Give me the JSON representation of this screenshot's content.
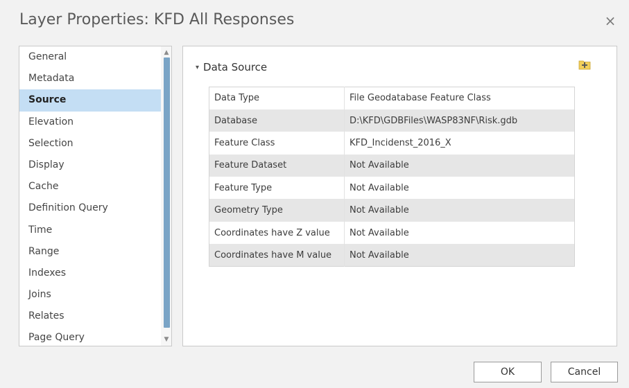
{
  "window": {
    "title": "Layer Properties: KFD All Responses",
    "close_glyph": "×"
  },
  "sidebar": {
    "selected": "Source",
    "items": [
      {
        "label": "General"
      },
      {
        "label": "Metadata"
      },
      {
        "label": "Source"
      },
      {
        "label": "Elevation"
      },
      {
        "label": "Selection"
      },
      {
        "label": "Display"
      },
      {
        "label": "Cache"
      },
      {
        "label": "Definition Query"
      },
      {
        "label": "Time"
      },
      {
        "label": "Range"
      },
      {
        "label": "Indexes"
      },
      {
        "label": "Joins"
      },
      {
        "label": "Relates"
      },
      {
        "label": "Page Query"
      }
    ]
  },
  "section": {
    "title": "Data Source",
    "chevron": "▾",
    "add_icon": "add-data-icon",
    "rows": [
      {
        "key": "Data Type",
        "value": "File Geodatabase Feature Class"
      },
      {
        "key": "Database",
        "value": "D:\\KFD\\GDBFiles\\WASP83NF\\Risk.gdb"
      },
      {
        "key": "Feature Class",
        "value": "KFD_Incidenst_2016_X"
      },
      {
        "key": "Feature Dataset",
        "value": "Not Available"
      },
      {
        "key": "Feature Type",
        "value": "Not Available"
      },
      {
        "key": "Geometry Type",
        "value": "Not Available"
      },
      {
        "key": "Coordinates have Z value",
        "value": "Not Available"
      },
      {
        "key": "Coordinates have M value",
        "value": "Not Available"
      }
    ]
  },
  "buttons": {
    "ok": "OK",
    "cancel": "Cancel"
  },
  "colors": {
    "selected_item": "#c4def4",
    "scroll_thumb": "#7aa4c6",
    "alt_row": "#e6e6e6",
    "folder_icon": "#f2cf5b"
  }
}
